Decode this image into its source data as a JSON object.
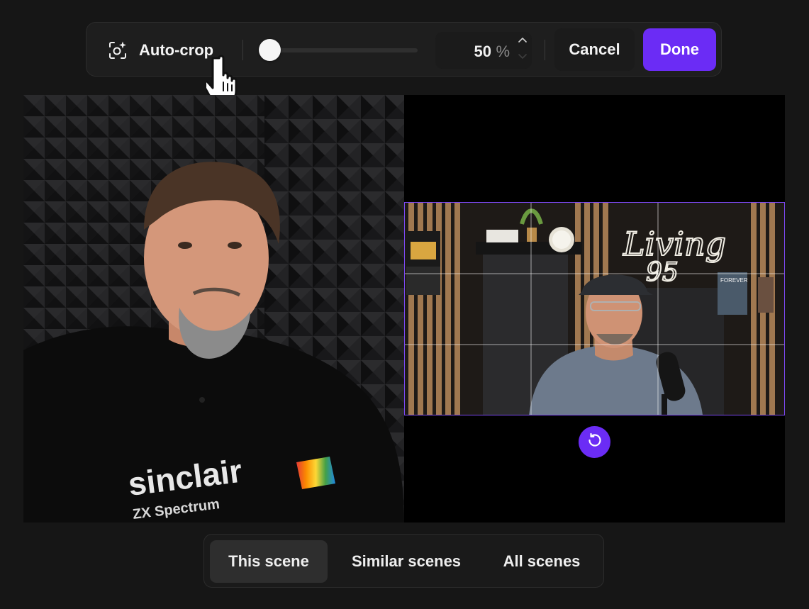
{
  "toolbar": {
    "autocrop_label": "Auto-crop",
    "zoom_percent": 50,
    "zoom_value": "50",
    "zoom_unit": "%",
    "cancel_label": "Cancel",
    "done_label": "Done"
  },
  "scope_tabs": [
    {
      "label": "This scene",
      "active": true
    },
    {
      "label": "Similar scenes",
      "active": false
    },
    {
      "label": "All scenes",
      "active": false
    }
  ],
  "left_video": {
    "shirt_brand": "sinclair",
    "shirt_sub": "ZX Spectrum"
  },
  "right_video": {
    "neon_text_1": "Living",
    "neon_text_2": "95",
    "book_text": "FOREVER"
  },
  "colors": {
    "accent": "#6b2cf5",
    "background": "#161616",
    "crop_border": "#7b48f0"
  },
  "icons": {
    "autocrop": "autocrop-icon",
    "stepper_up": "chevron-up-icon",
    "stepper_down": "chevron-down-icon",
    "reset": "rotate-ccw-icon",
    "cursor": "hand-pointer-icon"
  }
}
